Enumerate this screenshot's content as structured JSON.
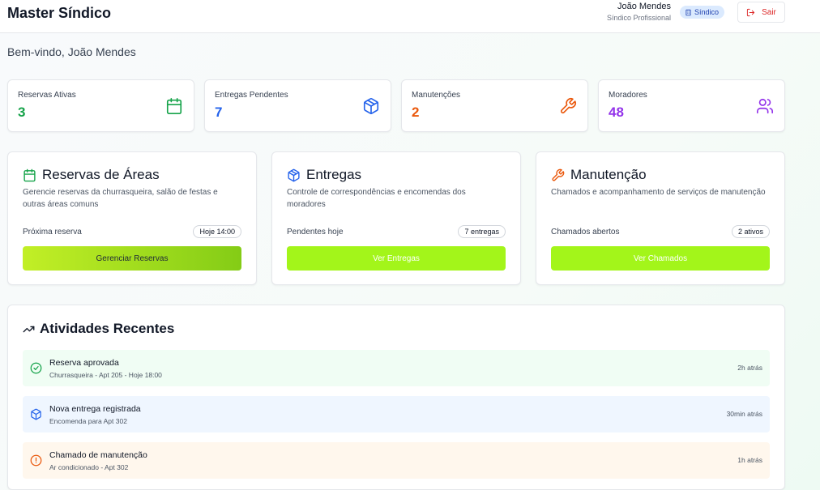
{
  "header": {
    "app_title": "Master Síndico",
    "user_name": "João Mendes",
    "user_role": "Síndico Profissional",
    "role_badge": "Síndico",
    "logout_label": "Sair"
  },
  "welcome": "Bem-vindo, João Mendes",
  "stats": [
    {
      "label": "Reservas Ativas",
      "value": "3",
      "icon": "calendar-icon",
      "color": "#16a34a"
    },
    {
      "label": "Entregas Pendentes",
      "value": "7",
      "icon": "package-icon",
      "color": "#2563eb"
    },
    {
      "label": "Manutenções",
      "value": "2",
      "icon": "wrench-icon",
      "color": "#ea580c"
    },
    {
      "label": "Moradores",
      "value": "48",
      "icon": "users-icon",
      "color": "#9333ea"
    }
  ],
  "features": [
    {
      "title": "Reservas de Áreas",
      "description": "Gerencie reservas da churrasqueira, salão de festas e outras áreas comuns",
      "meta_label": "Próxima reserva",
      "pill": "Hoje 14:00",
      "button": "Gerenciar Reservas",
      "icon": "calendar-icon",
      "color": "#16a34a"
    },
    {
      "title": "Entregas",
      "description": "Controle de correspondências e encomendas dos moradores",
      "meta_label": "Pendentes hoje",
      "pill": "7 entregas",
      "button": "Ver Entregas",
      "icon": "package-icon",
      "color": "#2563eb"
    },
    {
      "title": "Manutenção",
      "description": "Chamados e acompanhamento de serviços de manutenção",
      "meta_label": "Chamados abertos",
      "pill": "2 ativos",
      "button": "Ver Chamados",
      "icon": "wrench-icon",
      "color": "#ea580c"
    }
  ],
  "activities": {
    "title": "Atividades Recentes",
    "items": [
      {
        "name": "Reserva aprovada",
        "detail": "Churrasqueira - Apt 205 - Hoje 18:00",
        "time": "2h atrás",
        "icon": "check-circle-icon",
        "bg": "#f0fdf4",
        "color": "#16a34a"
      },
      {
        "name": "Nova entrega registrada",
        "detail": "Encomenda para Apt 302",
        "time": "30min atrás",
        "icon": "package-icon",
        "bg": "#eff6ff",
        "color": "#2563eb"
      },
      {
        "name": "Chamado de manutenção",
        "detail": "Ar condicionado - Apt 302",
        "time": "1h atrás",
        "icon": "alert-circle-icon",
        "bg": "#fff7ed",
        "color": "#ea580c"
      }
    ]
  }
}
